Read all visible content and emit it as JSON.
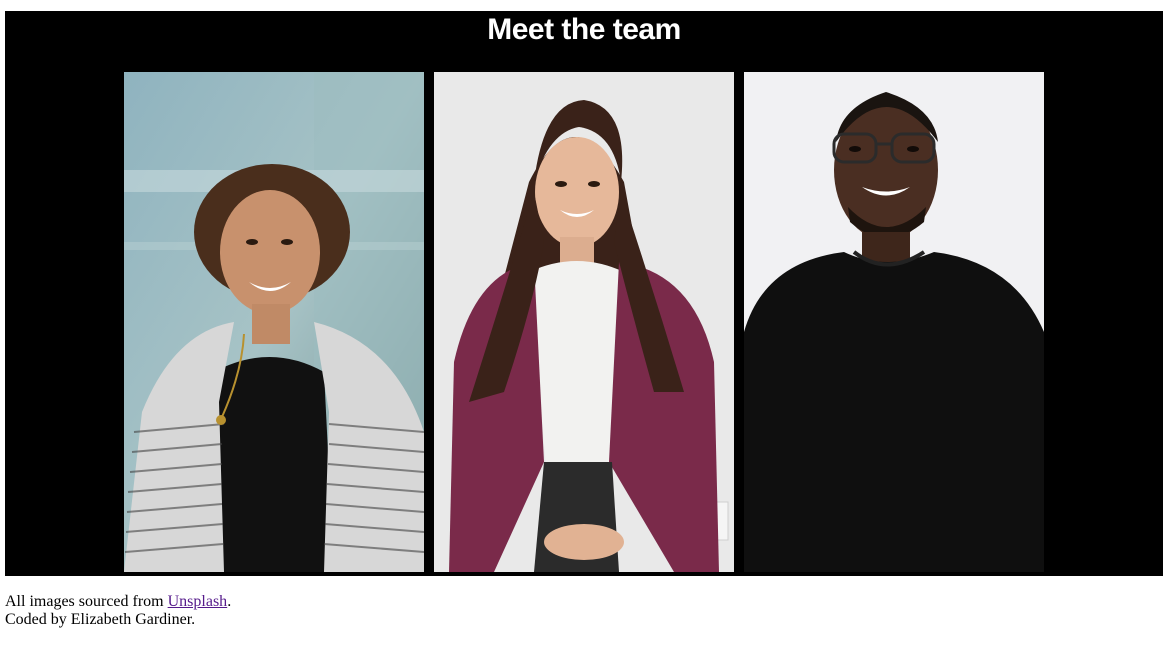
{
  "section": {
    "title": "Meet the team"
  },
  "team": [
    {
      "photo_label": "team-photo-curly-hair-woman"
    },
    {
      "photo_label": "team-photo-long-hair-woman"
    },
    {
      "photo_label": "team-photo-man-with-glasses"
    }
  ],
  "footer": {
    "credit_prefix": "All images sourced from ",
    "credit_link": "Unsplash",
    "credit_suffix": ".",
    "coded_by": "Coded by Elizabeth Gardiner."
  },
  "colors": {
    "section_background": "#000000",
    "heading_text": "#ffffff",
    "link_visited": "#551a8b"
  }
}
